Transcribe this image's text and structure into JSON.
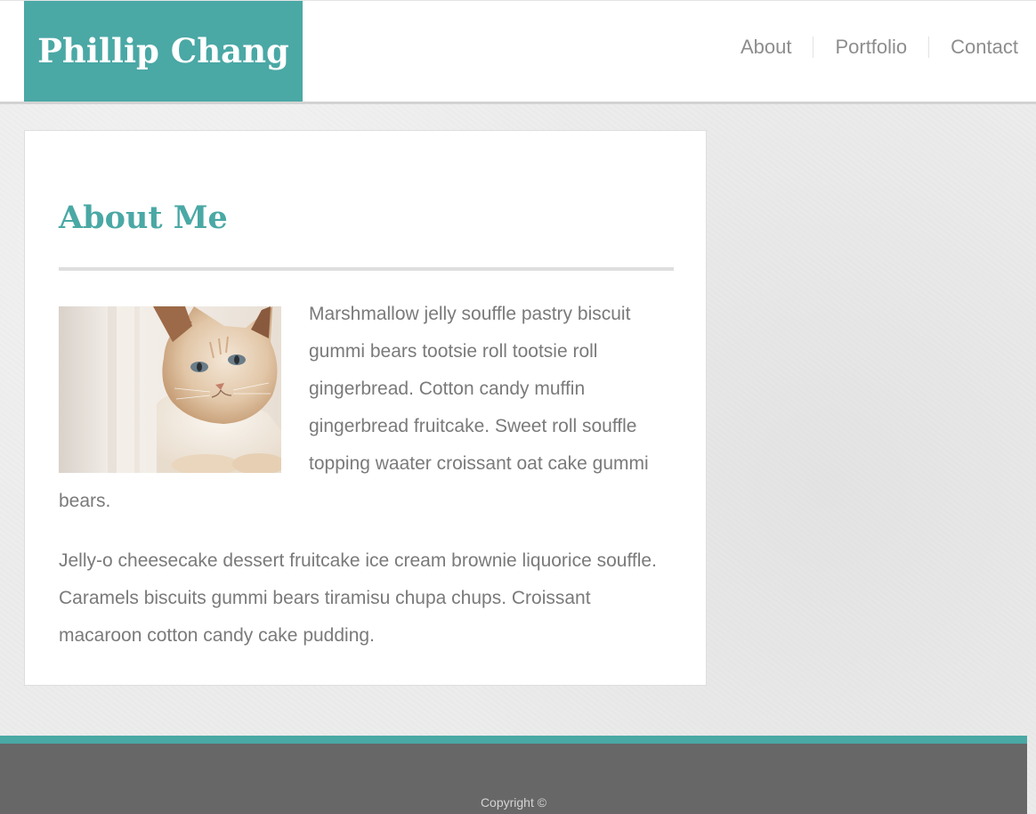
{
  "header": {
    "brand": "Phillip Chang",
    "nav": [
      {
        "label": "About"
      },
      {
        "label": "Portfolio"
      },
      {
        "label": "Contact"
      }
    ]
  },
  "main": {
    "title": "About Me",
    "photo_alt": "cat photo",
    "paragraphs": [
      "Marshmallow jelly souffle pastry biscuit gummi bears tootsie roll tootsie roll gingerbread. Cotton candy muffin gingerbread fruitcake. Sweet roll souffle topping waater croissant oat cake gummi bears.",
      "Jelly-o cheesecake dessert fruitcake ice cream brownie liquorice souffle. Caramels biscuits gummi bears tiramisu chupa chups. Croissant macaroon cotton candy cake pudding."
    ]
  },
  "footer": {
    "copyright": "Copyright ©"
  },
  "colors": {
    "accent": "#4aa8a5",
    "footer_bg": "#676768",
    "text": "#7a7a7a",
    "nav_text": "#8d8d8d"
  }
}
